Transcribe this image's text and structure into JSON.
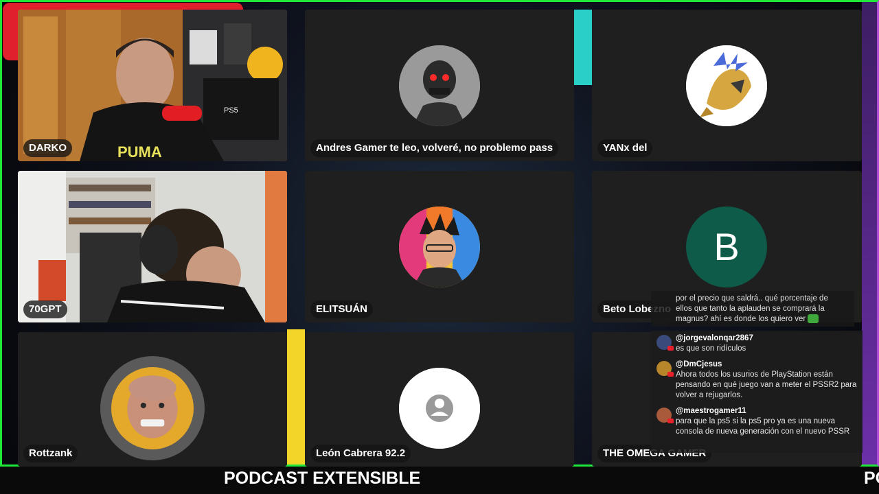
{
  "tiles": [
    {
      "name": "DARKO"
    },
    {
      "name": "Andres Gamer te leo, volveré, no problemo pass"
    },
    {
      "name": "YANx del"
    },
    {
      "name": "70GPT"
    },
    {
      "name": "ELITSUÁN"
    },
    {
      "name": "Beto Lobezno"
    },
    {
      "name": "Rottzank"
    },
    {
      "name": "León Cabrera 92.2"
    },
    {
      "name": "THE OMEGA GAMER"
    }
  ],
  "avatar_letter": "B",
  "cam_overlay_text": "PS5",
  "colors": {
    "border_green": "#20e83a",
    "beto_avatar": "#0f5b4a",
    "tile_bg": "#1f1f1f"
  },
  "chat": {
    "partial_message": "por el precio que saldrá.. qué porcentaje de ellos que tanto la aplauden se comprará la magnus? ahí es donde los quiero ver",
    "messages": [
      {
        "user": "@jorgevalonqar2867",
        "text": "es que son ridículos"
      },
      {
        "user": "@DmCjesus",
        "text": "Ahora todos los usurios de PlayStation están pensando en qué juego van a meter el PSSR2 para volver a rejugarlos."
      },
      {
        "user": "@maestrogamer11",
        "text": "para que la ps5 si la ps5 pro ya es una nueva consola de nueva generación con el nuevo PSSR"
      }
    ]
  },
  "ticker": {
    "text": "PODCAST EXTENSIBLE",
    "text_cut": "PO"
  }
}
